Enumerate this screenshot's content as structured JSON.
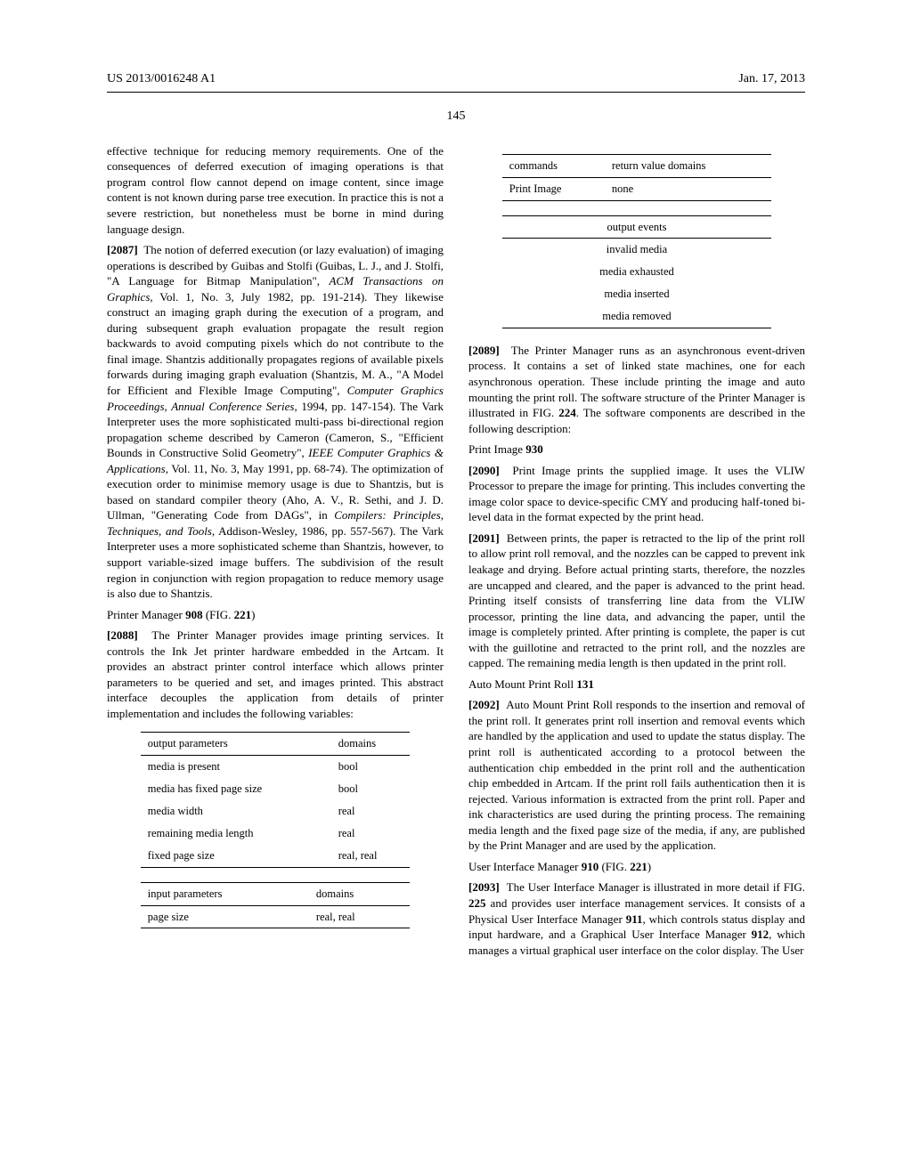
{
  "header": {
    "pubnum": "US 2013/0016248 A1",
    "pubdate": "Jan. 17, 2013"
  },
  "page_number": "145",
  "paragraphs": {
    "p0": "effective technique for reducing memory requirements. One of the consequences of deferred execution of imaging operations is that program control flow cannot depend on image content, since image content is not known during parse tree execution. In practice this is not a severe restriction, but nonetheless must be borne in mind during language design.",
    "p2087_num": "[2087]",
    "p2087_a": "The notion of deferred execution (or lazy evaluation) of imaging operations is described by Guibas and Stolfi (Guibas, L. J., and J. Stolfi, \"A Language for Bitmap Manipulation\", ",
    "p2087_b": "ACM Transactions on Graphics,",
    "p2087_c": " Vol. 1, No. 3, July 1982, pp. 191-214). They likewise construct an imaging graph during the execution of a program, and during subsequent graph evaluation propagate the result region backwards to avoid computing pixels which do not contribute to the final image. Shantzis additionally propagates regions of available pixels forwards during imaging graph evaluation (Shantzis, M. A., \"A Model for Efficient and Flexible Image Computing\", ",
    "p2087_d": "Computer Graphics Proceedings, Annual Conference Series,",
    "p2087_e": " 1994, pp. 147-154). The Vark Interpreter uses the more sophisticated multi-pass bi-directional region propagation scheme described by Cameron (Cameron, S., \"Efficient Bounds in Constructive Solid Geometry\", ",
    "p2087_f": "IEEE Computer Graphics & Applications,",
    "p2087_g": " Vol. 11, No. 3, May 1991, pp. 68-74). The optimization of execution order to minimise memory usage is due to Shantzis, but is based on standard compiler theory (Aho, A. V., R. Sethi, and J. D. Ullman, \"Generating Code from DAGs\", in ",
    "p2087_h": "Compilers: Principles, Techniques, and Tools,",
    "p2087_i": " Addison-Wesley, 1986, pp. 557-567). The Vark Interpreter uses a more sophisticated scheme than Shantzis, however, to support variable-sized image buffers. The subdivision of the result region in conjunction with region propagation to reduce memory usage is also due to Shantzis.",
    "h_printer_mgr_a": "Printer Manager ",
    "h_printer_mgr_b": "908",
    "h_printer_mgr_c": " (FIG. ",
    "h_printer_mgr_d": "221",
    "h_printer_mgr_e": ")",
    "p2088_num": "[2088]",
    "p2088": "The Printer Manager provides image printing services. It controls the Ink Jet printer hardware embedded in the Artcam. It provides an abstract printer control interface which allows printer parameters to be queried and set, and images printed. This abstract interface decouples the application from details of printer implementation and includes the following variables:",
    "p2089_num": "[2089]",
    "p2089_a": "The Printer Manager runs as an asynchronous event-driven process. It contains a set of linked state machines, one for each asynchronous operation. These include printing the image and auto mounting the print roll. The software structure of the Printer Manager is illustrated in FIG. ",
    "p2089_b": "224",
    "p2089_c": ". The software components are described in the following description:",
    "h_print_image_a": "Print Image ",
    "h_print_image_b": "930",
    "p2090_num": "[2090]",
    "p2090": "Print Image prints the supplied image. It uses the VLIW Processor to prepare the image for printing. This includes converting the image color space to device-specific CMY and producing half-toned bi-level data in the format expected by the print head.",
    "p2091_num": "[2091]",
    "p2091": "Between prints, the paper is retracted to the lip of the print roll to allow print roll removal, and the nozzles can be capped to prevent ink leakage and drying. Before actual printing starts, therefore, the nozzles are uncapped and cleared, and the paper is advanced to the print head. Printing itself consists of transferring line data from the VLIW processor, printing the line data, and advancing the paper, until the image is completely printed. After printing is complete, the paper is cut with the guillotine and retracted to the print roll, and the nozzles are capped. The remaining media length is then updated in the print roll.",
    "h_auto_mount_a": "Auto Mount Print Roll ",
    "h_auto_mount_b": "131",
    "p2092_num": "[2092]",
    "p2092": "Auto Mount Print Roll responds to the insertion and removal of the print roll. It generates print roll insertion and removal events which are handled by the application and used to update the status display. The print roll is authenticated according to a protocol between the authentication chip embedded in the print roll and the authentication chip embedded in Artcam. If the print roll fails authentication then it is rejected. Various information is extracted from the print roll. Paper and ink characteristics are used during the printing process. The remaining media length and the fixed page size of the media, if any, are published by the Print Manager and are used by the application.",
    "h_uimgr_a": "User Interface Manager ",
    "h_uimgr_b": "910",
    "h_uimgr_c": " (FIG. ",
    "h_uimgr_d": "221",
    "h_uimgr_e": ")",
    "p2093_num": "[2093]",
    "p2093_a": "The User Interface Manager is illustrated in more detail if FIG. ",
    "p2093_b": "225",
    "p2093_c": " and provides user interface management services. It consists of a Physical User Interface Manager ",
    "p2093_d": "911",
    "p2093_e": ", which controls status display and input hardware, and a Graphical User Interface Manager ",
    "p2093_f": "912",
    "p2093_g": ", which manages a virtual graphical user interface on the color display. The User"
  },
  "tables": {
    "output_params": {
      "h1": "output parameters",
      "h2": "domains",
      "rows": [
        {
          "c1": "media is present",
          "c2": "bool"
        },
        {
          "c1": "media has fixed page size",
          "c2": "bool"
        },
        {
          "c1": "media width",
          "c2": "real"
        },
        {
          "c1": "remaining media length",
          "c2": "real"
        },
        {
          "c1": "fixed page size",
          "c2": "real, real"
        }
      ]
    },
    "input_params": {
      "h1": "input parameters",
      "h2": "domains",
      "rows": [
        {
          "c1": "page size",
          "c2": "real, real"
        }
      ]
    },
    "commands": {
      "h1": "commands",
      "h2": "return value domains",
      "rows": [
        {
          "c1": "Print Image",
          "c2": "none"
        }
      ]
    },
    "output_events": {
      "h1": "output events",
      "rows": [
        {
          "c1": "invalid media"
        },
        {
          "c1": "media exhausted"
        },
        {
          "c1": "media inserted"
        },
        {
          "c1": "media removed"
        }
      ]
    }
  }
}
